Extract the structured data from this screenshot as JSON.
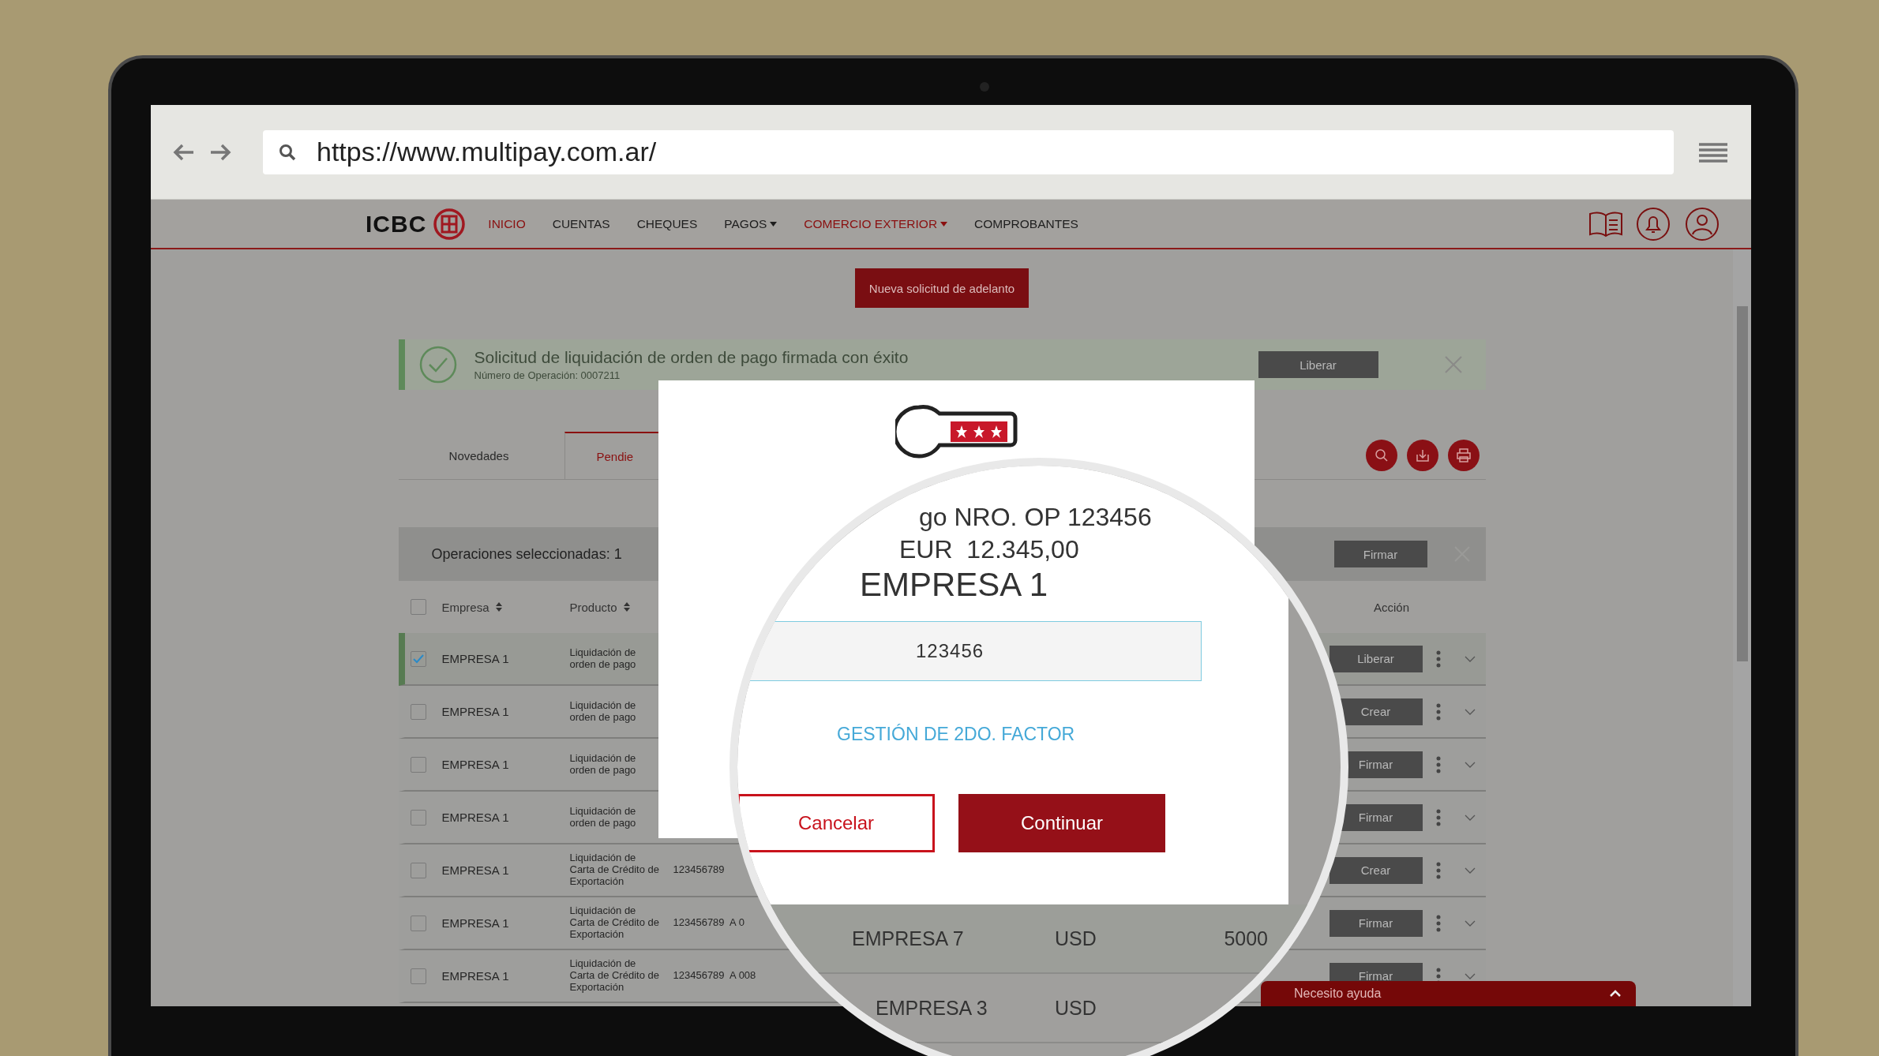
{
  "browser": {
    "url": "https://www.multipay.com.ar/"
  },
  "nav": {
    "logo": "ICBC",
    "items": [
      {
        "label": "INICIO",
        "highlighted": true,
        "dropdown": false
      },
      {
        "label": "CUENTAS",
        "highlighted": false,
        "dropdown": false
      },
      {
        "label": "CHEQUES",
        "highlighted": false,
        "dropdown": false
      },
      {
        "label": "PAGOS",
        "highlighted": false,
        "dropdown": true
      },
      {
        "label": "COMERCIO EXTERIOR",
        "highlighted": true,
        "dropdown": true
      },
      {
        "label": "COMPROBANTES",
        "highlighted": false,
        "dropdown": false
      }
    ]
  },
  "new_request_button": "Nueva solicitud de adelanto",
  "alert": {
    "title": "Solicitud de liquidación de orden  de pago firmada con éxito",
    "subtitle": "Número de Operación: 0007211",
    "button": "Liberar"
  },
  "tabs": [
    {
      "label": "Novedades",
      "selected": false
    },
    {
      "label": "Pendie",
      "selected": true
    }
  ],
  "selection_bar": {
    "text": "Operaciones seleccionadas: 1",
    "button": "Firmar"
  },
  "table": {
    "columns": [
      "Empresa",
      "Producto",
      "Acción"
    ],
    "select_all_checked": false,
    "rows": [
      {
        "checked": true,
        "empresa": "EMPRESA 1",
        "producto": "Liquidación de orden de pago",
        "action": "Liberar"
      },
      {
        "checked": false,
        "empresa": "EMPRESA 1",
        "producto": "Liquidación de orden de pago",
        "action": "Crear"
      },
      {
        "checked": false,
        "empresa": "EMPRESA 1",
        "producto": "Liquidación de orden de pago",
        "action": "Firmar"
      },
      {
        "checked": false,
        "empresa": "EMPRESA 1",
        "producto": "Liquidación de orden de pago",
        "action": "Firmar"
      },
      {
        "checked": false,
        "empresa": "EMPRESA 1",
        "producto": "Liquidación de Carta de Crédito de Exportación",
        "column_3": "123456789",
        "action": "Crear"
      },
      {
        "checked": false,
        "empresa": "EMPRESA 1",
        "producto": "Liquidación de Carta de Crédito de Exportación",
        "column_3": "123456789  A 0",
        "action": "Firmar"
      },
      {
        "checked": false,
        "empresa": "EMPRESA 1",
        "producto": "Liquidación de Carta de Crédito de Exportación",
        "column_3": "123456789  A 008",
        "action": "Firmar"
      }
    ]
  },
  "help_bar": {
    "label": "Necesito ayuda"
  },
  "modal": {
    "details": [
      "go NRO. OP 123456",
      "EUR  12.345,00",
      "EMPRESA 1"
    ],
    "code_field": {
      "value": "123456"
    },
    "link": "GESTIÓN DE 2DO. FACTOR",
    "buttons": [
      {
        "label": "Cancelar",
        "kind": "secondary"
      },
      {
        "label": "Continuar",
        "kind": "primary"
      }
    ]
  },
  "magnified_rows": [
    {
      "empresa": "EMPRESA 7",
      "currency": "USD",
      "amount": "5000"
    },
    {
      "empresa": "EMPRESA 3",
      "currency": "USD"
    }
  ]
}
